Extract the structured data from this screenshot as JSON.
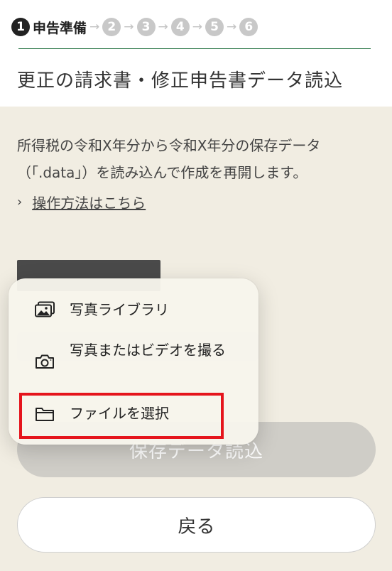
{
  "header": {
    "steps": {
      "current_number": "1",
      "current_label": "申告準備",
      "others": [
        "2",
        "3",
        "4",
        "5",
        "6"
      ],
      "arrow": "→"
    },
    "title": "更正の請求書・修正申告書データ読込"
  },
  "main": {
    "description": "所得税の令和X年分から令和X年分の保存データ（「.data」）を読み込んで作成を再開します。",
    "howto_chevron": "›",
    "howto_link": "操作方法はこちら",
    "load_button": "保存データ読込",
    "back_button": "戻る"
  },
  "popup_menu": {
    "items": [
      {
        "label": "写真ライブラリ",
        "icon": "photo-library-icon"
      },
      {
        "label": "写真またはビデオを撮る",
        "icon": "camera-icon"
      },
      {
        "label": "ファイルを選択",
        "icon": "folder-icon"
      }
    ]
  },
  "colors": {
    "background": "#f1ede2",
    "header_rule": "#2f7a4b",
    "highlight": "#e5141c",
    "disabled_button": "#cfcdc7"
  }
}
